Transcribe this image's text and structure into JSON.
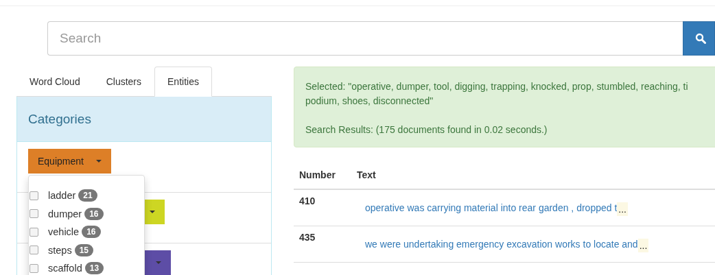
{
  "search": {
    "placeholder": "Search"
  },
  "tabs": [
    {
      "label": "Word Cloud",
      "selected": false
    },
    {
      "label": "Clusters",
      "selected": false
    },
    {
      "label": "Entities",
      "selected": true
    }
  ],
  "categories_panel": {
    "title": "Categories",
    "categories": [
      {
        "label": "Equipment",
        "color": "#dd7f27",
        "menu_items": [
          {
            "label": "ladder",
            "count": "21",
            "checked": false
          },
          {
            "label": "dumper",
            "count": "16",
            "checked": false
          },
          {
            "label": "vehicle",
            "count": "16",
            "checked": false
          },
          {
            "label": "steps",
            "count": "15",
            "checked": false
          },
          {
            "label": "scaffold",
            "count": "13",
            "checked": false
          }
        ]
      },
      {
        "color": "#cdd623"
      },
      {
        "color": "#5d4da6"
      }
    ]
  },
  "alert": {
    "selected_lines": [
      "Selected: \"operative, dumper, tool, digging, trapping, knocked, prop, stumbled, reaching, ti",
      "podium, shoes, disconnected\""
    ],
    "results": "Search Results: (175 documents found in 0.02 seconds.)"
  },
  "table": {
    "columns": [
      "Number",
      "Text"
    ],
    "rows": [
      {
        "number": "410",
        "text": "operative was carrying material into rear garden , dropped t",
        "more": "..."
      },
      {
        "number": "435",
        "text": "we were undertaking emergency excavation works to locate and",
        "more": "..."
      }
    ]
  }
}
